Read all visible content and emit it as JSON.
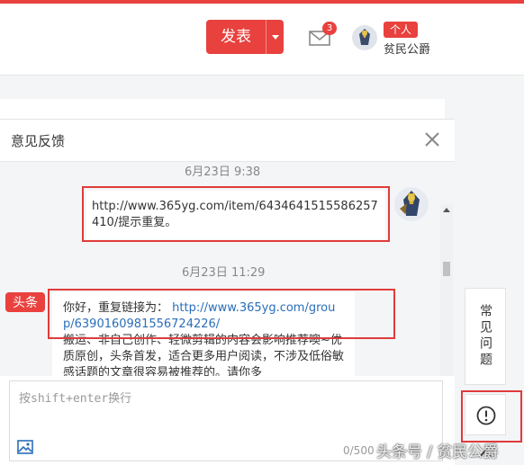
{
  "header": {
    "publish_label": "发表",
    "mail_badge": "3",
    "user_tag": "个人",
    "user_name": "贫民公爵"
  },
  "feedback": {
    "title": "意见反馈",
    "messages": [
      {
        "time": "6月23日 9:38",
        "side": "right",
        "text": "http://www.365yg.com/item/6434641515586257410/提示重复。"
      },
      {
        "time": "6月23日 11:29",
        "side": "left",
        "sender_logo": "头条",
        "lead": "你好，重复链接为：",
        "link": "http://www.365yg.com/group/6390160981556724226/",
        "text": "搬运、非自己创作、轻微剪辑的内容会影响推荐噢~优质原创，头条首发，适合更多用户阅读，不涉及低俗敏感话题的文章很容易被推荐的。请你多"
      }
    ],
    "compose": {
      "placeholder": "按shift+enter换行",
      "counter": "0/500"
    }
  },
  "side_tabs": {
    "faq_label": "常见问题"
  },
  "watermark": "头条号 / 贫民公爵",
  "colors": {
    "brand_red": "#e8413e",
    "link_blue": "#2a6eb8",
    "highlight_box": "#e03b3b"
  },
  "icons": [
    "mail-icon",
    "close-icon",
    "image-icon",
    "feedback-icon",
    "chevron-up-icon",
    "caret-down-icon"
  ]
}
